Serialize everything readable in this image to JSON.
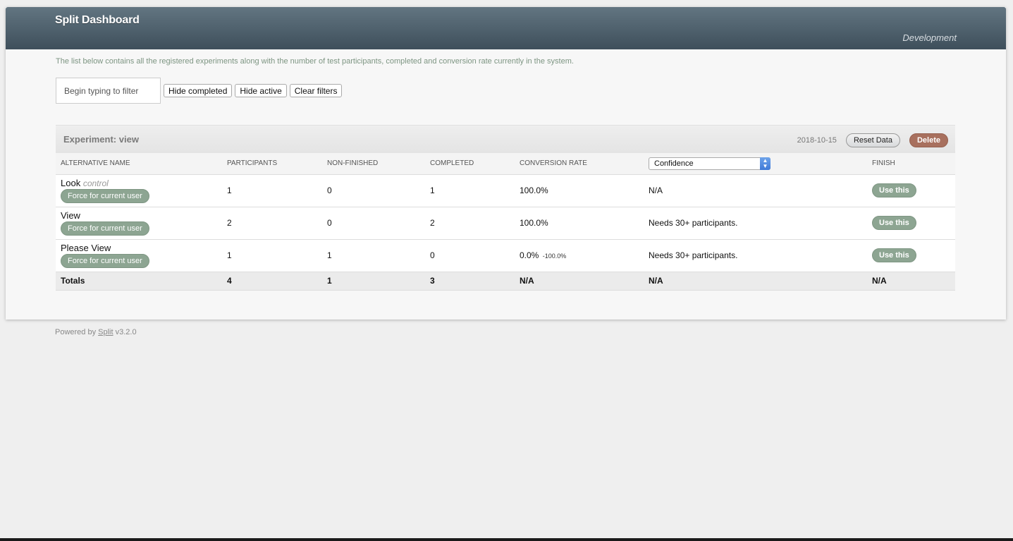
{
  "header": {
    "title": "Split Dashboard",
    "environment": "Development"
  },
  "intro": "The list below contains all the registered experiments along with the number of test participants, completed and conversion rate currently in the system.",
  "filters": {
    "placeholder": "Begin typing to filter",
    "hide_completed": "Hide completed",
    "hide_active": "Hide active",
    "clear_filters": "Clear filters"
  },
  "experiment": {
    "title": "Experiment: view",
    "date": "2018-10-15",
    "reset_label": "Reset Data",
    "delete_label": "Delete",
    "columns": {
      "alternative": "Alternative Name",
      "participants": "Participants",
      "non_finished": "Non-Finished",
      "completed": "Completed",
      "conversion": "Conversion Rate",
      "confidence_select": "Confidence",
      "finish": "Finish"
    },
    "alternatives": [
      {
        "name": "Look",
        "tag": "control",
        "force_label": "Force for current user",
        "participants": "1",
        "non_finished": "0",
        "completed": "1",
        "conversion": "100.0%",
        "diff": "",
        "confidence": "N/A",
        "use_label": "Use this"
      },
      {
        "name": "View",
        "tag": "",
        "force_label": "Force for current user",
        "participants": "2",
        "non_finished": "0",
        "completed": "2",
        "conversion": "100.0%",
        "diff": "",
        "confidence": "Needs 30+ participants.",
        "use_label": "Use this"
      },
      {
        "name": "Please View",
        "tag": "",
        "force_label": "Force for current user",
        "participants": "1",
        "non_finished": "1",
        "completed": "0",
        "conversion": "0.0%",
        "diff": "-100.0%",
        "confidence": "Needs 30+ participants.",
        "use_label": "Use this"
      }
    ],
    "totals": {
      "label": "Totals",
      "participants": "4",
      "non_finished": "1",
      "completed": "3",
      "conversion": "N/A",
      "confidence": "N/A",
      "finish": "N/A"
    }
  },
  "footer": {
    "prefix": "Powered by",
    "link": "Split",
    "version": "v3.2.0"
  }
}
